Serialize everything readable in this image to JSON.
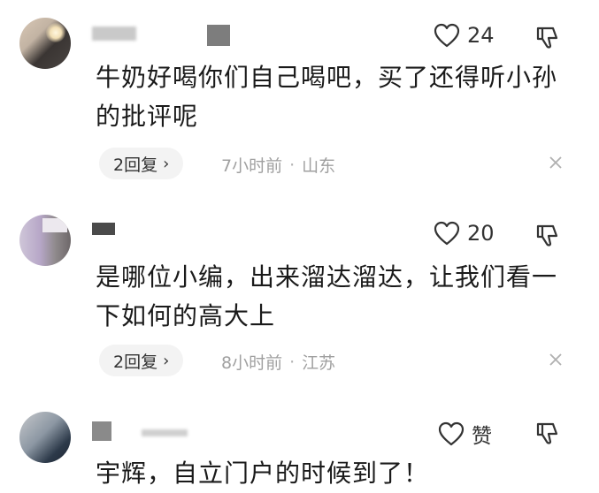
{
  "comments": [
    {
      "likes": "24",
      "text": "牛奶好喝你们自己喝吧，买了还得听小孙的批评呢",
      "reply_label": "2回复",
      "time": "7小时前",
      "location": "山东"
    },
    {
      "likes": "20",
      "text": "是哪位小编，出来溜达溜达，让我们看一下如何的高大上",
      "reply_label": "2回复",
      "time": "8小时前",
      "location": "江苏"
    },
    {
      "likes": "赞",
      "text": "宇辉，自立门户的时候到了！"
    }
  ],
  "separator": "·",
  "icons": {
    "like": "heart-outline-icon",
    "dislike": "thumbs-down-icon",
    "close": "close-icon",
    "chevron": "chevron-right-icon"
  }
}
